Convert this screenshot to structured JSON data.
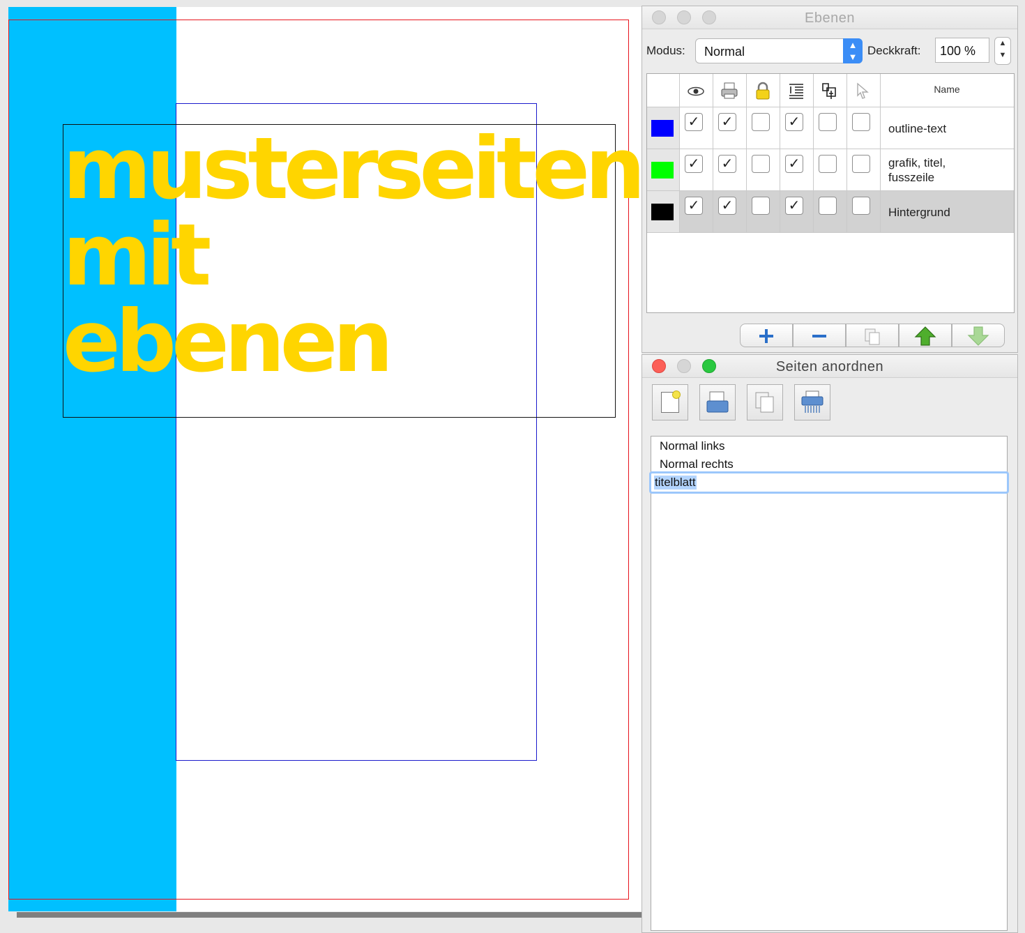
{
  "document": {
    "headline_lines": [
      "musterseiten",
      "mit",
      "ebenen"
    ],
    "colors": {
      "bar": "#00c0ff",
      "text": "#ffd500"
    }
  },
  "layers_panel": {
    "title": "Ebenen",
    "mode_label": "Modus:",
    "mode_value": "Normal",
    "opacity_label": "Deckkraft:",
    "opacity_value": "100 %",
    "header_icons": [
      "eye-icon",
      "printer-icon",
      "lock-icon",
      "text-flow-icon",
      "outline-icon",
      "pointer-icon"
    ],
    "column_name": "Name",
    "layers": [
      {
        "name": "outline-text",
        "color": "#0000ff",
        "checks": [
          true,
          true,
          false,
          true,
          false,
          false
        ]
      },
      {
        "name": "grafik, titel, fusszeile",
        "color": "#00ff00",
        "checks": [
          true,
          true,
          false,
          true,
          false,
          false
        ]
      },
      {
        "name": "Hintergrund",
        "color": "#000000",
        "checks": [
          true,
          true,
          false,
          true,
          false,
          false
        ],
        "selected": true
      }
    ],
    "buttons": [
      "plus-icon",
      "minus-icon",
      "duplicate-icon",
      "move-up-icon",
      "move-down-icon"
    ]
  },
  "pages_panel": {
    "title": "Seiten anordnen",
    "toolbar": [
      "new-page-icon",
      "load-page-icon",
      "copy-page-icon",
      "delete-page-icon"
    ],
    "pages": [
      "Normal links",
      "Normal rechts"
    ],
    "editing": "titelblatt"
  }
}
